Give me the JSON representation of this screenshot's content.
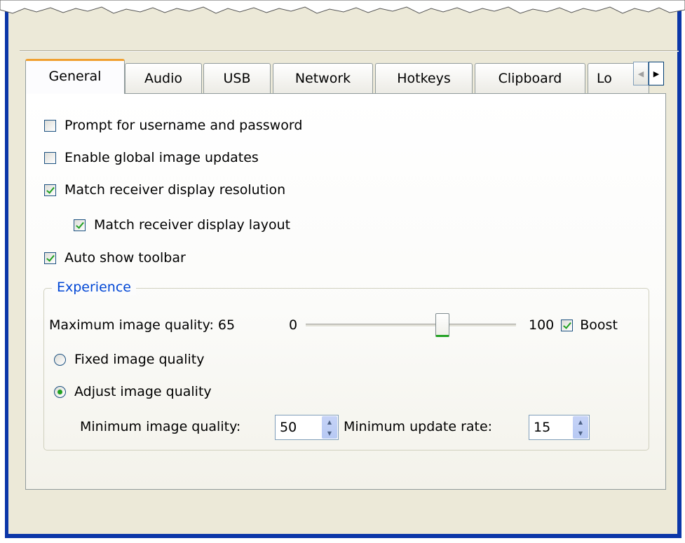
{
  "tabs": [
    {
      "label": "General",
      "active": true
    },
    {
      "label": "Audio"
    },
    {
      "label": "USB"
    },
    {
      "label": "Network"
    },
    {
      "label": "Hotkeys"
    },
    {
      "label": "Clipboard"
    },
    {
      "label": "Lo"
    }
  ],
  "tab_scroll": {
    "left_icon": "chevron-left-icon",
    "right_icon": "chevron-right-icon"
  },
  "options": {
    "prompt_credentials": {
      "label": "Prompt for username and password",
      "checked": false
    },
    "global_image_updates": {
      "label": "Enable global image updates",
      "checked": false
    },
    "match_resolution": {
      "label": "Match receiver display resolution",
      "checked": true
    },
    "match_layout": {
      "label": "Match receiver display layout",
      "checked": true
    },
    "auto_toolbar": {
      "label": "Auto show toolbar",
      "checked": true
    }
  },
  "experience": {
    "legend": "Experience",
    "max_quality_label": "Maximum image quality: 65",
    "slider_min": "0",
    "slider_max": "100",
    "slider_value": 65,
    "boost_label": "Boost",
    "boost_checked": true,
    "fixed_label": "Fixed image quality",
    "adjust_label": "Adjust image quality",
    "selected_mode": "adjust",
    "min_quality_label": "Minimum image quality:",
    "min_quality_value": "50",
    "min_rate_label": "Minimum update rate:",
    "min_rate_value": "15"
  },
  "colors": {
    "window_border": "#0b36a8",
    "active_tab_accent": "#f0a030",
    "group_legend": "#0046d5",
    "check_mark": "#21a121"
  }
}
